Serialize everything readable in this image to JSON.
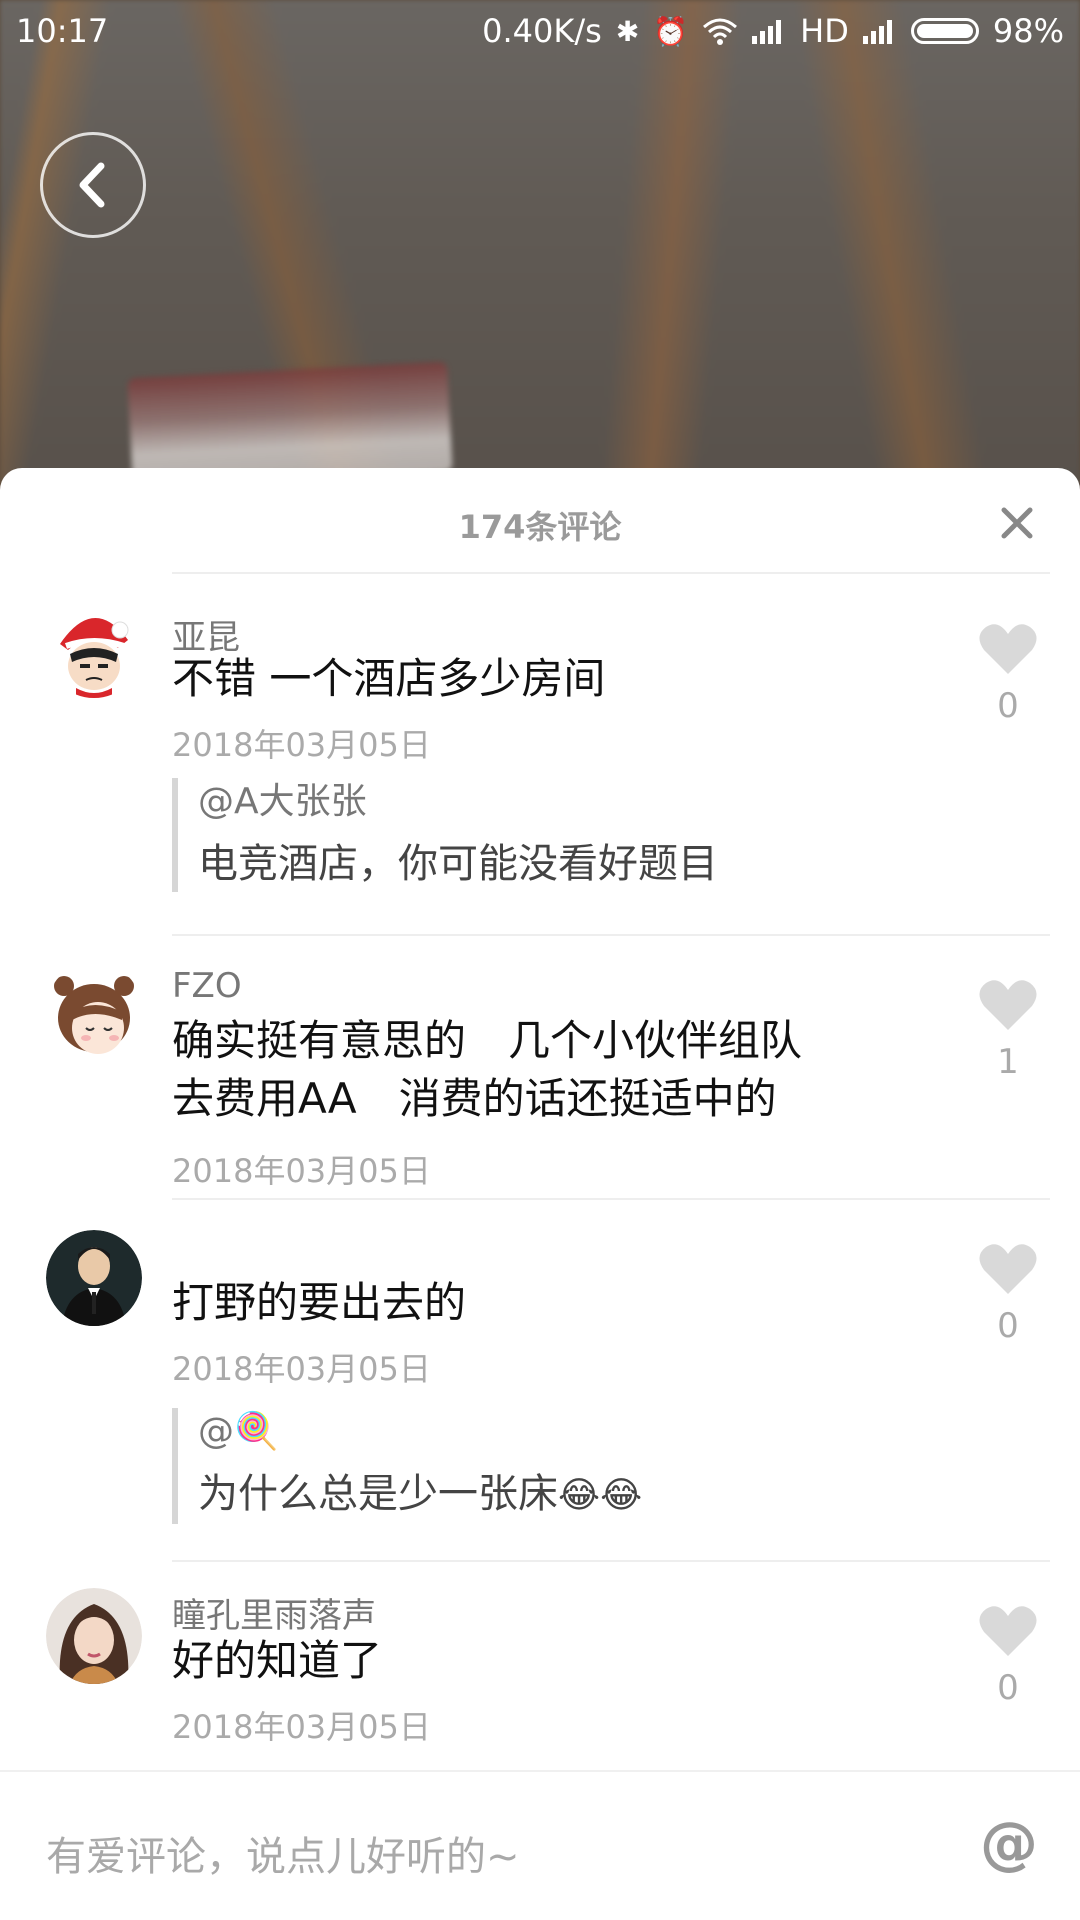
{
  "status_bar": {
    "time": "10:17",
    "speed": "0.40K/s",
    "network": "HD",
    "battery": "98%"
  },
  "sheet": {
    "title": "174条评论"
  },
  "comments": [
    {
      "user": "亚昆",
      "text": "不错 一个酒店多少房间",
      "date": "2018年03月05日",
      "likes": "0",
      "reply": {
        "user": "@A大张张",
        "text": "电竞酒店，你可能没看好题目"
      }
    },
    {
      "user": "FZO",
      "text_line1": "确实挺有意思的　几个小伙伴组队",
      "text_line2": "去费用AA　消费的话还挺适中的",
      "date": "2018年03月05日",
      "likes": "1"
    },
    {
      "user": "",
      "text": "打野的要出去的",
      "date": "2018年03月05日",
      "likes": "0",
      "reply": {
        "user": "@",
        "user_emoji": "🍭",
        "text": "为什么总是少一张床",
        "text_emoji": "😂😂"
      }
    },
    {
      "user": "瞳孔里雨落声",
      "text": "好的知道了",
      "date": "2018年03月05日",
      "likes": "0"
    }
  ],
  "input": {
    "placeholder": "有爱评论，说点儿好听的~",
    "at_label": "@"
  },
  "icons": {
    "back": "chevron-left-icon",
    "close": "close-icon",
    "like": "heart-icon"
  }
}
